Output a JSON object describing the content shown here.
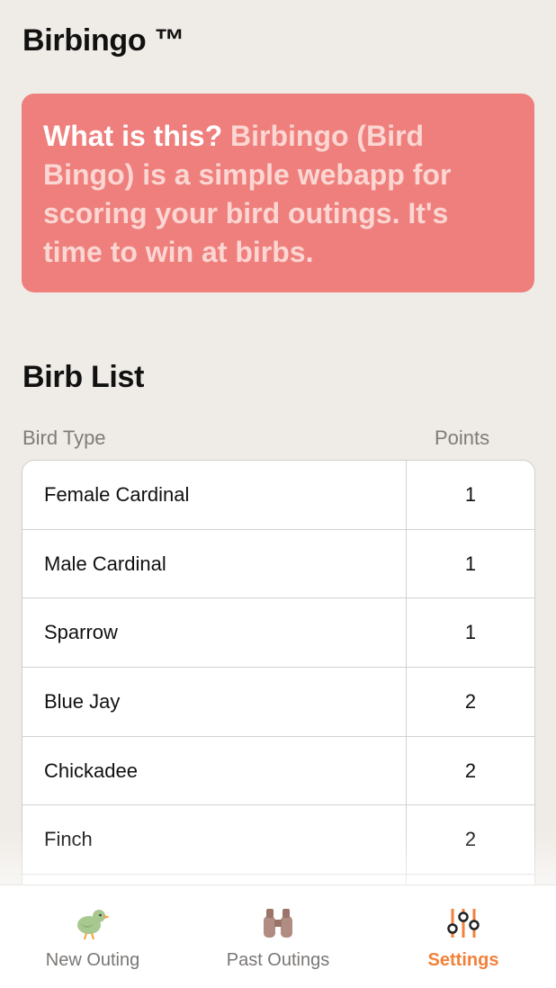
{
  "app": {
    "title": "Birbingo ™"
  },
  "info_card": {
    "question": "What is this?",
    "text": " Birbingo (Bird Bingo) is a simple webapp for scoring your bird outings. It's time to win at birbs."
  },
  "birb_list": {
    "title": "Birb List",
    "columns": {
      "type": "Bird Type",
      "points": "Points"
    },
    "rows": [
      {
        "name": "Female Cardinal",
        "points": "1"
      },
      {
        "name": "Male Cardinal",
        "points": "1"
      },
      {
        "name": "Sparrow",
        "points": "1"
      },
      {
        "name": "Blue Jay",
        "points": "2"
      },
      {
        "name": "Chickadee",
        "points": "2"
      },
      {
        "name": "Finch",
        "points": "2"
      },
      {
        "name": "",
        "points": ""
      }
    ]
  },
  "nav": {
    "items": [
      {
        "label": "New Outing",
        "icon": "bird-icon",
        "active": false
      },
      {
        "label": "Past Outings",
        "icon": "binoculars-icon",
        "active": false
      },
      {
        "label": "Settings",
        "icon": "sliders-icon",
        "active": true
      }
    ]
  },
  "colors": {
    "background": "#efebe6",
    "card": "#ef7f7c",
    "accent": "#f2813a"
  }
}
